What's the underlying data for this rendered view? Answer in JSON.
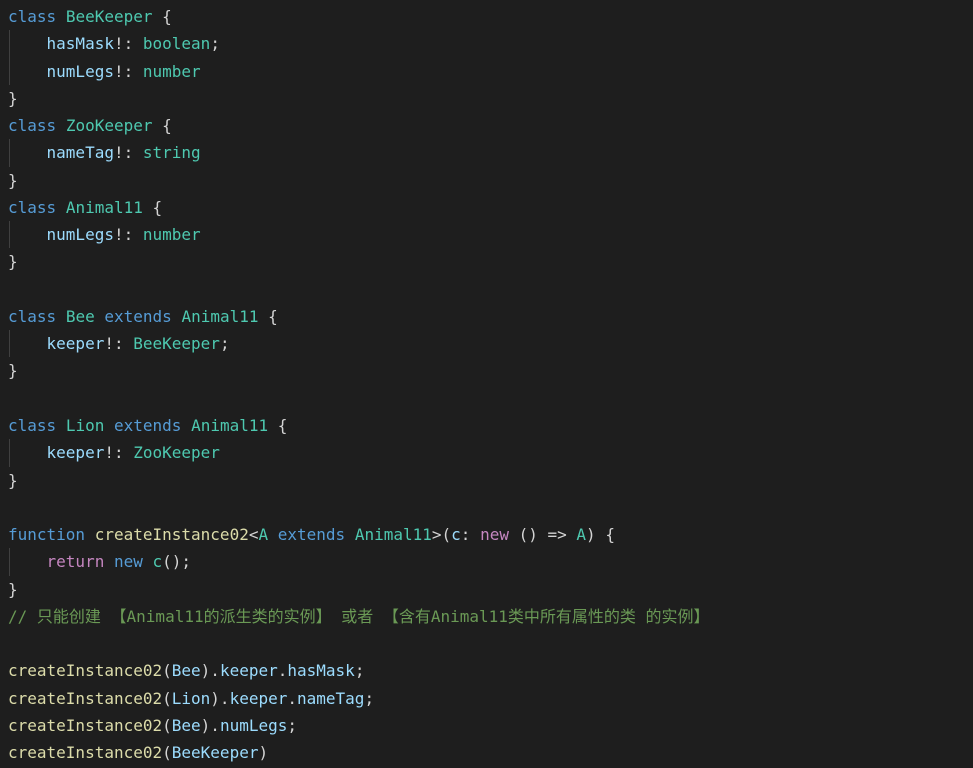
{
  "editor": {
    "background_color": "#1e1e1e",
    "font_size_px": 16,
    "line_height_px": 27.28,
    "language": "TypeScript",
    "colors": {
      "keyword": "#569cd6",
      "control_keyword": "#c586c0",
      "type": "#4ec9b0",
      "property": "#9cdcfe",
      "function": "#dcdcaa",
      "plain": "#d4d4d4",
      "comment": "#6a9955",
      "indent_guide": "#404040"
    }
  },
  "code_lines": [
    {
      "id": "line-1",
      "indent": false,
      "tokens": [
        {
          "t": "class",
          "c": "keyword"
        },
        {
          "t": " ",
          "c": "plain"
        },
        {
          "t": "BeeKeeper",
          "c": "type"
        },
        {
          "t": " {",
          "c": "plain"
        }
      ]
    },
    {
      "id": "line-2",
      "indent": true,
      "tokens": [
        {
          "t": "    ",
          "c": "plain"
        },
        {
          "t": "hasMask",
          "c": "prop"
        },
        {
          "t": "!",
          "c": "plain"
        },
        {
          "t": ": ",
          "c": "plain"
        },
        {
          "t": "boolean",
          "c": "type"
        },
        {
          "t": ";",
          "c": "plain"
        }
      ]
    },
    {
      "id": "line-3",
      "indent": true,
      "tokens": [
        {
          "t": "    ",
          "c": "plain"
        },
        {
          "t": "numLegs",
          "c": "prop"
        },
        {
          "t": "!",
          "c": "plain"
        },
        {
          "t": ": ",
          "c": "plain"
        },
        {
          "t": "number",
          "c": "type"
        }
      ]
    },
    {
      "id": "line-4",
      "indent": false,
      "tokens": [
        {
          "t": "}",
          "c": "plain"
        }
      ]
    },
    {
      "id": "line-5",
      "indent": false,
      "tokens": [
        {
          "t": "class",
          "c": "keyword"
        },
        {
          "t": " ",
          "c": "plain"
        },
        {
          "t": "ZooKeeper",
          "c": "type"
        },
        {
          "t": " {",
          "c": "plain"
        }
      ]
    },
    {
      "id": "line-6",
      "indent": true,
      "tokens": [
        {
          "t": "    ",
          "c": "plain"
        },
        {
          "t": "nameTag",
          "c": "prop"
        },
        {
          "t": "!",
          "c": "plain"
        },
        {
          "t": ": ",
          "c": "plain"
        },
        {
          "t": "string",
          "c": "type"
        }
      ]
    },
    {
      "id": "line-7",
      "indent": false,
      "tokens": [
        {
          "t": "}",
          "c": "plain"
        }
      ]
    },
    {
      "id": "line-8",
      "indent": false,
      "tokens": [
        {
          "t": "class",
          "c": "keyword"
        },
        {
          "t": " ",
          "c": "plain"
        },
        {
          "t": "Animal11",
          "c": "type"
        },
        {
          "t": " {",
          "c": "plain"
        }
      ]
    },
    {
      "id": "line-9",
      "indent": true,
      "tokens": [
        {
          "t": "    ",
          "c": "plain"
        },
        {
          "t": "numLegs",
          "c": "prop"
        },
        {
          "t": "!",
          "c": "plain"
        },
        {
          "t": ": ",
          "c": "plain"
        },
        {
          "t": "number",
          "c": "type"
        }
      ]
    },
    {
      "id": "line-10",
      "indent": false,
      "tokens": [
        {
          "t": "}",
          "c": "plain"
        }
      ]
    },
    {
      "id": "line-11",
      "indent": false,
      "tokens": []
    },
    {
      "id": "line-12",
      "indent": false,
      "tokens": [
        {
          "t": "class",
          "c": "keyword"
        },
        {
          "t": " ",
          "c": "plain"
        },
        {
          "t": "Bee",
          "c": "type"
        },
        {
          "t": " ",
          "c": "plain"
        },
        {
          "t": "extends",
          "c": "keyword"
        },
        {
          "t": " ",
          "c": "plain"
        },
        {
          "t": "Animal11",
          "c": "type"
        },
        {
          "t": " {",
          "c": "plain"
        }
      ]
    },
    {
      "id": "line-13",
      "indent": true,
      "tokens": [
        {
          "t": "    ",
          "c": "plain"
        },
        {
          "t": "keeper",
          "c": "prop"
        },
        {
          "t": "!",
          "c": "plain"
        },
        {
          "t": ": ",
          "c": "plain"
        },
        {
          "t": "BeeKeeper",
          "c": "type"
        },
        {
          "t": ";",
          "c": "plain"
        }
      ]
    },
    {
      "id": "line-14",
      "indent": false,
      "tokens": [
        {
          "t": "}",
          "c": "plain"
        }
      ]
    },
    {
      "id": "line-15",
      "indent": false,
      "tokens": []
    },
    {
      "id": "line-16",
      "indent": false,
      "tokens": [
        {
          "t": "class",
          "c": "keyword"
        },
        {
          "t": " ",
          "c": "plain"
        },
        {
          "t": "Lion",
          "c": "type"
        },
        {
          "t": " ",
          "c": "plain"
        },
        {
          "t": "extends",
          "c": "keyword"
        },
        {
          "t": " ",
          "c": "plain"
        },
        {
          "t": "Animal11",
          "c": "type"
        },
        {
          "t": " {",
          "c": "plain"
        }
      ]
    },
    {
      "id": "line-17",
      "indent": true,
      "tokens": [
        {
          "t": "    ",
          "c": "plain"
        },
        {
          "t": "keeper",
          "c": "prop"
        },
        {
          "t": "!",
          "c": "plain"
        },
        {
          "t": ": ",
          "c": "plain"
        },
        {
          "t": "ZooKeeper",
          "c": "type"
        }
      ]
    },
    {
      "id": "line-18",
      "indent": false,
      "tokens": [
        {
          "t": "}",
          "c": "plain"
        }
      ]
    },
    {
      "id": "line-19",
      "indent": false,
      "tokens": []
    },
    {
      "id": "line-20",
      "indent": false,
      "tokens": [
        {
          "t": "function",
          "c": "keyword"
        },
        {
          "t": " ",
          "c": "plain"
        },
        {
          "t": "createInstance02",
          "c": "func"
        },
        {
          "t": "<",
          "c": "plain"
        },
        {
          "t": "A",
          "c": "type"
        },
        {
          "t": " ",
          "c": "plain"
        },
        {
          "t": "extends",
          "c": "keyword"
        },
        {
          "t": " ",
          "c": "plain"
        },
        {
          "t": "Animal11",
          "c": "type"
        },
        {
          "t": ">(",
          "c": "plain"
        },
        {
          "t": "c",
          "c": "prop"
        },
        {
          "t": ": ",
          "c": "plain"
        },
        {
          "t": "new",
          "c": "control"
        },
        {
          "t": " () ",
          "c": "plain"
        },
        {
          "t": "=>",
          "c": "plain"
        },
        {
          "t": " ",
          "c": "plain"
        },
        {
          "t": "A",
          "c": "type"
        },
        {
          "t": ") {",
          "c": "plain"
        }
      ]
    },
    {
      "id": "line-21",
      "indent": true,
      "tokens": [
        {
          "t": "    ",
          "c": "plain"
        },
        {
          "t": "return",
          "c": "control"
        },
        {
          "t": " ",
          "c": "plain"
        },
        {
          "t": "new",
          "c": "keyword"
        },
        {
          "t": " ",
          "c": "plain"
        },
        {
          "t": "c",
          "c": "type"
        },
        {
          "t": "();",
          "c": "plain"
        }
      ]
    },
    {
      "id": "line-22",
      "indent": false,
      "tokens": [
        {
          "t": "}",
          "c": "plain"
        }
      ]
    },
    {
      "id": "line-23",
      "indent": false,
      "tokens": [
        {
          "t": "// 只能创建 【Animal11的派生类的实例】 或者 【含有Animal11类中所有属性的类 的实例】",
          "c": "comment"
        }
      ]
    },
    {
      "id": "line-24",
      "indent": false,
      "tokens": []
    },
    {
      "id": "line-25",
      "indent": false,
      "tokens": [
        {
          "t": "createInstance02",
          "c": "func"
        },
        {
          "t": "(",
          "c": "plain"
        },
        {
          "t": "Bee",
          "c": "prop"
        },
        {
          "t": ").",
          "c": "plain"
        },
        {
          "t": "keeper",
          "c": "prop"
        },
        {
          "t": ".",
          "c": "plain"
        },
        {
          "t": "hasMask",
          "c": "prop"
        },
        {
          "t": ";",
          "c": "plain"
        }
      ]
    },
    {
      "id": "line-26",
      "indent": false,
      "tokens": [
        {
          "t": "createInstance02",
          "c": "func"
        },
        {
          "t": "(",
          "c": "plain"
        },
        {
          "t": "Lion",
          "c": "prop"
        },
        {
          "t": ").",
          "c": "plain"
        },
        {
          "t": "keeper",
          "c": "prop"
        },
        {
          "t": ".",
          "c": "plain"
        },
        {
          "t": "nameTag",
          "c": "prop"
        },
        {
          "t": ";",
          "c": "plain"
        }
      ]
    },
    {
      "id": "line-27",
      "indent": false,
      "tokens": [
        {
          "t": "createInstance02",
          "c": "func"
        },
        {
          "t": "(",
          "c": "plain"
        },
        {
          "t": "Bee",
          "c": "prop"
        },
        {
          "t": ").",
          "c": "plain"
        },
        {
          "t": "numLegs",
          "c": "prop"
        },
        {
          "t": ";",
          "c": "plain"
        }
      ]
    },
    {
      "id": "line-28",
      "indent": false,
      "tokens": [
        {
          "t": "createInstance02",
          "c": "func"
        },
        {
          "t": "(",
          "c": "plain"
        },
        {
          "t": "BeeKeeper",
          "c": "prop"
        },
        {
          "t": ")",
          "c": "plain"
        }
      ]
    }
  ]
}
